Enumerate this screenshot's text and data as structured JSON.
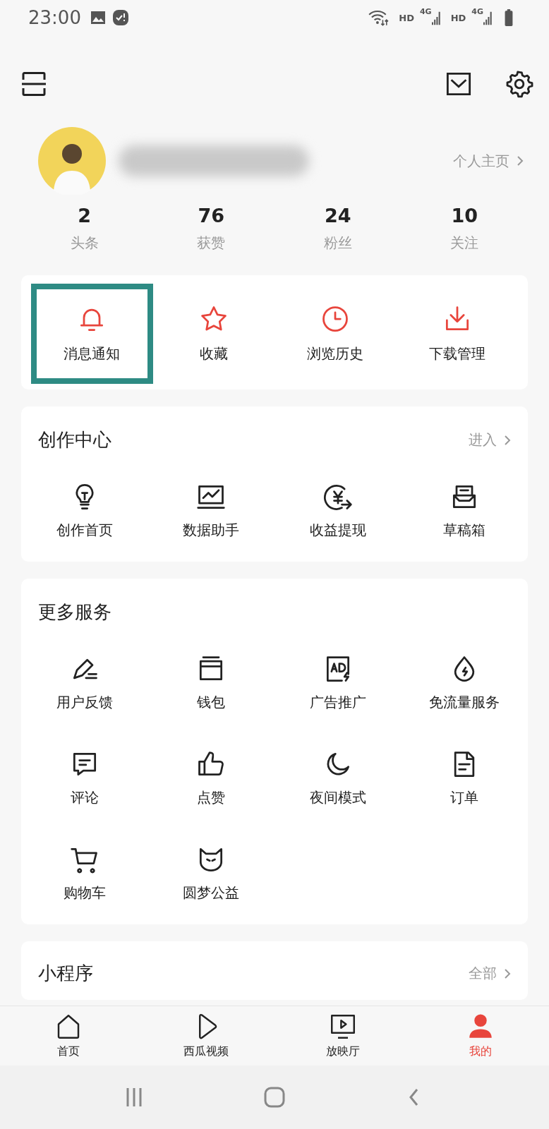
{
  "status_bar": {
    "time": "23:00",
    "network": [
      {
        "hd": "HD",
        "gen": "4G"
      },
      {
        "hd": "HD",
        "gen": "4G"
      }
    ]
  },
  "profile": {
    "homepage_link": "个人主页"
  },
  "stats": [
    {
      "value": "2",
      "label": "头条"
    },
    {
      "value": "76",
      "label": "获赞"
    },
    {
      "value": "24",
      "label": "粉丝"
    },
    {
      "value": "10",
      "label": "关注"
    }
  ],
  "quick_actions": [
    {
      "kind": "bell",
      "label": "消息通知",
      "highlighted": true
    },
    {
      "kind": "star",
      "label": "收藏",
      "highlighted": false
    },
    {
      "kind": "clock",
      "label": "浏览历史",
      "highlighted": false
    },
    {
      "kind": "download",
      "label": "下载管理",
      "highlighted": false
    }
  ],
  "creator_center": {
    "title": "创作中心",
    "link": "进入",
    "items": [
      {
        "kind": "bulb",
        "label": "创作首页"
      },
      {
        "kind": "chart",
        "label": "数据助手"
      },
      {
        "kind": "yen",
        "label": "收益提现"
      },
      {
        "kind": "inbox",
        "label": "草稿箱"
      }
    ]
  },
  "more_services": {
    "title": "更多服务",
    "items": [
      {
        "kind": "pen",
        "label": "用户反馈"
      },
      {
        "kind": "wallet",
        "label": "钱包"
      },
      {
        "kind": "ad",
        "label": "广告推广"
      },
      {
        "kind": "drop",
        "label": "免流量服务"
      },
      {
        "kind": "comment",
        "label": "评论"
      },
      {
        "kind": "thumb",
        "label": "点赞"
      },
      {
        "kind": "moon",
        "label": "夜间模式"
      },
      {
        "kind": "doc",
        "label": "订单"
      },
      {
        "kind": "cart",
        "label": "购物车"
      },
      {
        "kind": "cat",
        "label": "圆梦公益"
      }
    ]
  },
  "mini_programs": {
    "title": "小程序",
    "link": "全部"
  },
  "tab_bar": [
    {
      "kind": "home",
      "label": "首页",
      "selected": false
    },
    {
      "kind": "play",
      "label": "西瓜视频",
      "selected": false
    },
    {
      "kind": "tv",
      "label": "放映厅",
      "selected": false
    },
    {
      "kind": "person",
      "label": "我的",
      "selected": true
    }
  ]
}
